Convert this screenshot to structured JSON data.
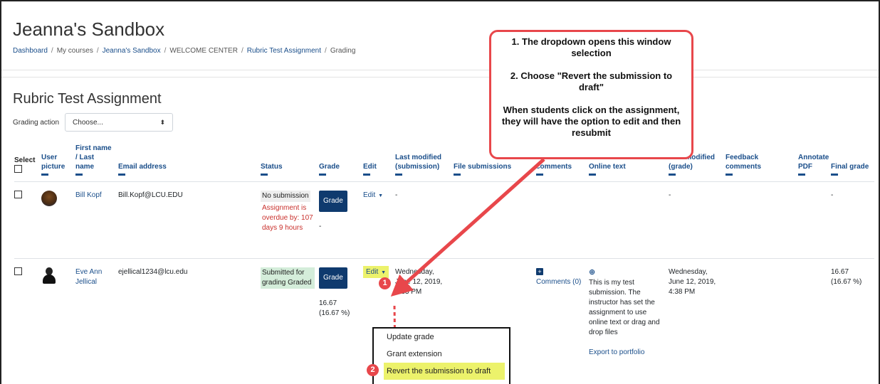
{
  "site": {
    "title": "Jeanna's Sandbox",
    "breadcrumb": [
      "Dashboard",
      "My courses",
      "Jeanna's Sandbox",
      "WELCOME CENTER",
      "Rubric Test Assignment",
      "Grading"
    ]
  },
  "page": {
    "title": "Rubric Test Assignment",
    "grading_action_label": "Grading action",
    "grading_action_value": "Choose...",
    "select_arrow": "⬍"
  },
  "table": {
    "headers": {
      "select": "Select",
      "user_picture": "User picture",
      "name": "First name / Last name",
      "email": "Email address",
      "status": "Status",
      "grade": "Grade",
      "edit": "Edit",
      "last_modified_submission": "Last modified (submission)",
      "file_submissions": "File submissions",
      "submission_comments": "Submission comments",
      "online_text": "Online text",
      "last_modified_grade": "Last modified (grade)",
      "feedback_comments": "Feedback comments",
      "annotate_pdf": "Annotate PDF",
      "final_grade": "Final grade"
    },
    "rows": [
      {
        "name": "Bill Kopf",
        "email": "Bill.Kopf@LCU.EDU",
        "status_main": "No submission",
        "status_overdue": "Assignment is overdue by: 107 days 9 hours",
        "grade_button": "Grade",
        "grade_value": "-",
        "edit": "Edit",
        "last_modified": "-",
        "last_modified_grade": "-",
        "final_grade": "-"
      },
      {
        "name": "Eve Ann Jellical",
        "email": "ejellical1234@lcu.edu",
        "status_main": "Submitted for grading Graded",
        "grade_button": "Grade",
        "grade_value": "16.67 (16.67 %)",
        "edit": "Edit",
        "last_modified": "Wednesday, June 12, 2019, 4:33 PM",
        "comments_label": "Comments (0)",
        "online_text": "This is my test submission. The instructor has set the assignment to use online text or drag and drop files",
        "export_link": "Export to portfolio",
        "last_modified_grade": "Wednesday, June 12, 2019, 4:38 PM",
        "final_grade": "16.67 (16.67 %)"
      }
    ]
  },
  "callout": {
    "line1": "1. The dropdown opens this window selection",
    "line2": "2. Choose \"Revert the submission to draft\"",
    "line3": "When students click on the assignment, they will have the option to edit and then resubmit"
  },
  "dropdown": {
    "items": [
      "Update grade",
      "Grant extension",
      "Revert the submission to draft"
    ]
  },
  "markers": [
    "1",
    "2"
  ],
  "colors": {
    "link": "#1a4e8a",
    "button": "#0f3a6e",
    "annotation_red": "#e8474b",
    "highlight_yellow": "#ecf26b",
    "overdue_red": "#c9302c",
    "submitted_green": "#d4edda"
  }
}
